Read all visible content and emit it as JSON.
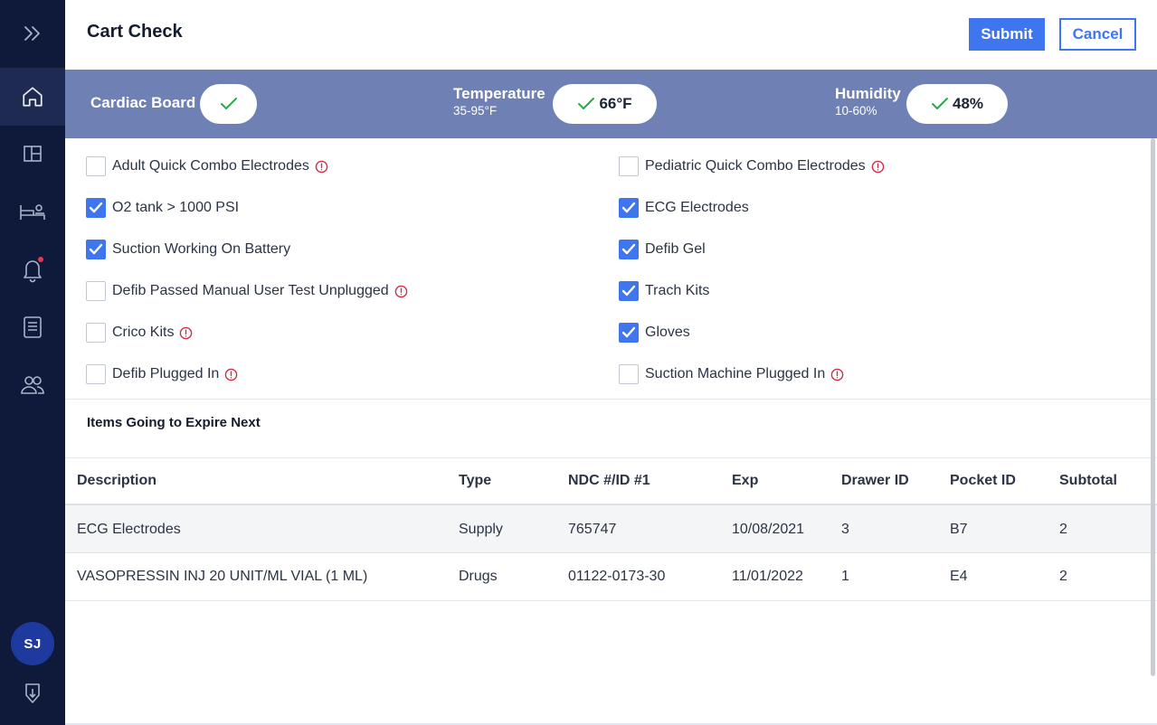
{
  "sidebar": {
    "icons": [
      "expand-chevrons-icon",
      "home-icon",
      "layout-icon",
      "bed-icon",
      "bell-icon",
      "document-icon",
      "users-icon",
      "download-icon"
    ],
    "avatar_initials": "SJ",
    "notification_color": "#e53950"
  },
  "header": {
    "title": "Cart Check",
    "submit_label": "Submit",
    "cancel_label": "Cancel"
  },
  "status_band": {
    "cardiac_board": {
      "label": "Cardiac Board",
      "status": "ok"
    },
    "temperature": {
      "label": "Temperature",
      "range": "35-95°F",
      "value": "66°F",
      "status": "ok"
    },
    "humidity": {
      "label": "Humidity",
      "range": "10-60%",
      "value": "48%",
      "status": "ok"
    }
  },
  "checklist": {
    "left": [
      {
        "label": "Adult Quick Combo Electrodes",
        "checked": false,
        "warning": true
      },
      {
        "label": "O2 tank > 1000 PSI",
        "checked": true,
        "warning": false
      },
      {
        "label": "Suction Working On Battery",
        "checked": true,
        "warning": false
      },
      {
        "label": "Defib Passed Manual User Test Unplugged",
        "checked": false,
        "warning": true
      },
      {
        "label": "Crico Kits",
        "checked": false,
        "warning": true
      },
      {
        "label": "Defib Plugged In",
        "checked": false,
        "warning": true
      }
    ],
    "right": [
      {
        "label": "Pediatric Quick Combo Electrodes",
        "checked": false,
        "warning": true
      },
      {
        "label": "ECG Electrodes",
        "checked": true,
        "warning": false
      },
      {
        "label": "Defib Gel",
        "checked": true,
        "warning": false
      },
      {
        "label": "Trach Kits",
        "checked": true,
        "warning": false
      },
      {
        "label": "Gloves",
        "checked": true,
        "warning": false
      },
      {
        "label": "Suction Machine Plugged In",
        "checked": false,
        "warning": true
      }
    ]
  },
  "expiring": {
    "title": "Items Going to Expire Next",
    "columns": [
      "Description",
      "Type",
      "NDC #/ID #1",
      "Exp",
      "Drawer ID",
      "Pocket ID",
      "Subtotal"
    ],
    "rows": [
      [
        "ECG Electrodes",
        "Supply",
        "765747",
        "10/08/2021",
        "3",
        "B7",
        "2"
      ],
      [
        "VASOPRESSIN INJ 20 UNIT/ML VIAL (1 ML)",
        "Drugs",
        "01122-0173-30",
        "11/01/2022",
        "1",
        "E4",
        "2"
      ]
    ]
  },
  "colors": {
    "sidebar_bg": "#0f1a3a",
    "band_bg": "#6f80b4",
    "accent": "#3f75ee",
    "ok_check": "#2aa84a",
    "warning": "#d12d47"
  }
}
